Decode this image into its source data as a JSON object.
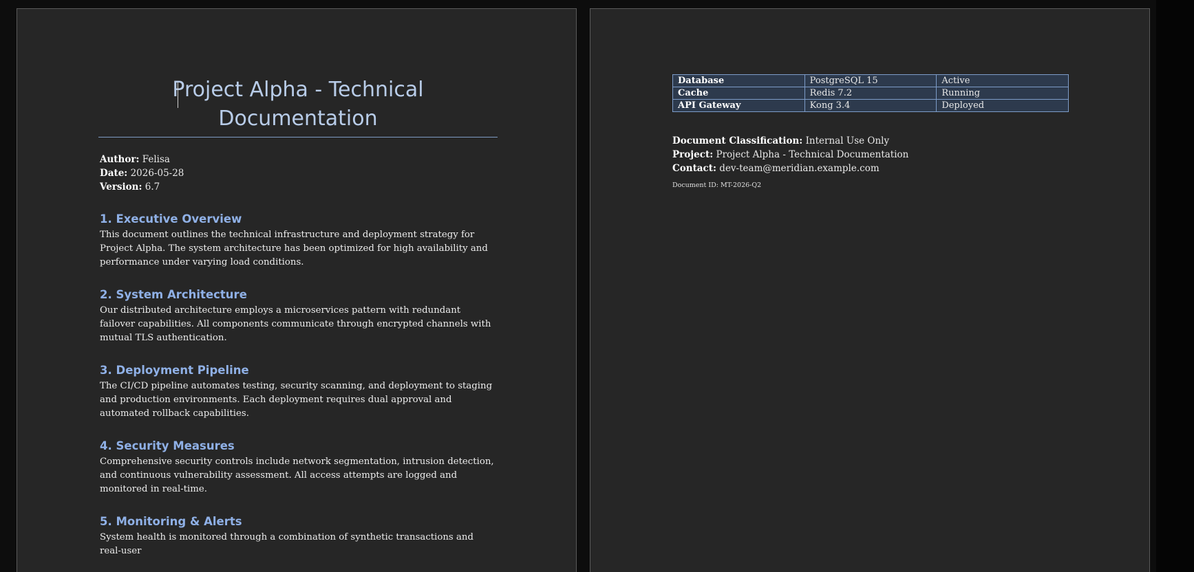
{
  "document": {
    "title": "Project Alpha - Technical Documentation",
    "meta": [
      {
        "label": "Author:",
        "value": "Felisa"
      },
      {
        "label": "Date:",
        "value": "2026-05-28"
      },
      {
        "label": "Version:",
        "value": "6.7"
      }
    ],
    "sections": [
      {
        "heading": "1. Executive Overview",
        "body": "This document outlines the technical infrastructure and deployment strategy for Project Alpha. The system architecture has been optimized for high availability and performance under varying load conditions."
      },
      {
        "heading": "2. System Architecture",
        "body": "Our distributed architecture employs a microservices pattern with redundant failover capabilities. All components communicate through encrypted channels with mutual TLS authentication."
      },
      {
        "heading": "3. Deployment Pipeline",
        "body": "The CI/CD pipeline automates testing, security scanning, and deployment to staging and production environments. Each deployment requires dual approval and automated rollback capabilities."
      },
      {
        "heading": "4. Security Measures",
        "body": "Comprehensive security controls include network segmentation, intrusion detection, and continuous vulnerability assessment. All access attempts are logged and monitored in real-time."
      },
      {
        "heading": "5. Monitoring & Alerts",
        "body": "System health is monitored through a combination of synthetic transactions and real-user"
      }
    ]
  },
  "status_table": {
    "rows": [
      [
        "Database",
        "PostgreSQL 15",
        "Active"
      ],
      [
        "Cache",
        "Redis 7.2",
        "Running"
      ],
      [
        "API Gateway",
        "Kong 3.4",
        "Deployed"
      ]
    ]
  },
  "footer_info": [
    {
      "label": "Document Classification:",
      "value": "Internal Use Only"
    },
    {
      "label": "Project:",
      "value": "Project Alpha - Technical Documentation"
    },
    {
      "label": "Contact:",
      "value": "dev-team@meridian.example.com"
    }
  ],
  "doc_id": "Document ID: MT-2026-Q2",
  "colors": {
    "heading": "#8fb0e6",
    "title": "#b8cce8",
    "page_bg": "#262626",
    "table_border": "#7d9cc9"
  }
}
